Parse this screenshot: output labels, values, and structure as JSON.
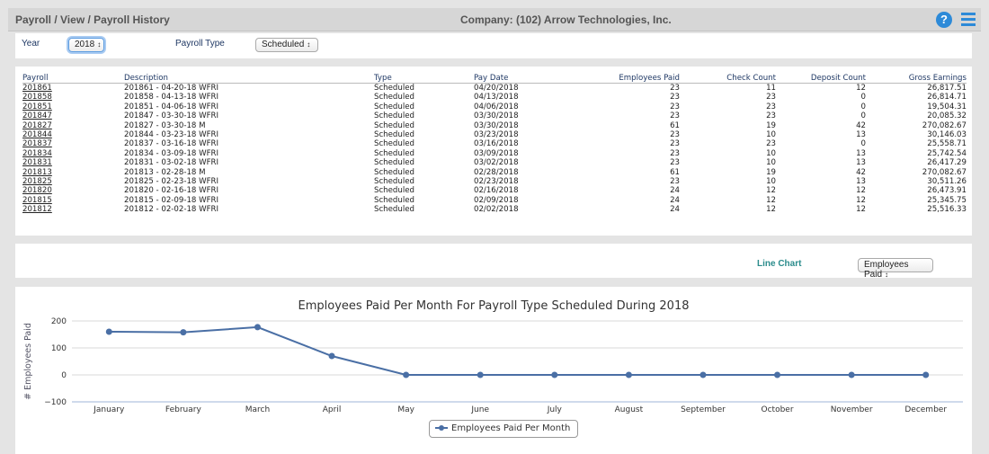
{
  "header": {
    "breadcrumb": "Payroll / View / Payroll History",
    "company": "Company: (102) Arrow Technologies, Inc.",
    "help_icon": "question-icon",
    "menu_icon": "list-menu-icon"
  },
  "filters": {
    "year_label": "Year",
    "year_value": "2018",
    "payroll_type_label": "Payroll Type",
    "payroll_type_value": "Scheduled"
  },
  "table": {
    "headers": [
      "Payroll",
      "Description",
      "Type",
      "Pay Date",
      "Employees Paid",
      "Check Count",
      "Deposit Count",
      "Gross Earnings"
    ],
    "rows": [
      [
        "201861",
        "201861 - 04-20-18 WFRI",
        "Scheduled",
        "04/20/2018",
        "23",
        "11",
        "12",
        "26,817.51"
      ],
      [
        "201858",
        "201858 - 04-13-18 WFRI",
        "Scheduled",
        "04/13/2018",
        "23",
        "23",
        "0",
        "26,814.71"
      ],
      [
        "201851",
        "201851 - 04-06-18 WFRI",
        "Scheduled",
        "04/06/2018",
        "23",
        "23",
        "0",
        "19,504.31"
      ],
      [
        "201847",
        "201847 - 03-30-18 WFRI",
        "Scheduled",
        "03/30/2018",
        "23",
        "23",
        "0",
        "20,085.32"
      ],
      [
        "201827",
        "201827 - 03-30-18 M",
        "Scheduled",
        "03/30/2018",
        "61",
        "19",
        "42",
        "270,082.67"
      ],
      [
        "201844",
        "201844 - 03-23-18 WFRI",
        "Scheduled",
        "03/23/2018",
        "23",
        "10",
        "13",
        "30,146.03"
      ],
      [
        "201837",
        "201837 - 03-16-18 WFRI",
        "Scheduled",
        "03/16/2018",
        "23",
        "23",
        "0",
        "25,558.71"
      ],
      [
        "201834",
        "201834 - 03-09-18 WFRI",
        "Scheduled",
        "03/09/2018",
        "23",
        "10",
        "13",
        "25,742.54"
      ],
      [
        "201831",
        "201831 - 03-02-18 WFRI",
        "Scheduled",
        "03/02/2018",
        "23",
        "10",
        "13",
        "26,417.29"
      ],
      [
        "201813",
        "201813 - 02-28-18 M",
        "Scheduled",
        "02/28/2018",
        "61",
        "19",
        "42",
        "270,082.67"
      ],
      [
        "201825",
        "201825 - 02-23-18 WFRI",
        "Scheduled",
        "02/23/2018",
        "23",
        "10",
        "13",
        "30,511.26"
      ],
      [
        "201820",
        "201820 - 02-16-18 WFRI",
        "Scheduled",
        "02/16/2018",
        "24",
        "12",
        "12",
        "26,473.91"
      ],
      [
        "201815",
        "201815 - 02-09-18 WFRI",
        "Scheduled",
        "02/09/2018",
        "24",
        "12",
        "12",
        "25,345.75"
      ],
      [
        "201812",
        "201812 - 02-02-18 WFRI",
        "Scheduled",
        "02/02/2018",
        "24",
        "12",
        "12",
        "25,516.33"
      ]
    ]
  },
  "chart_controls": {
    "label": "Line Chart",
    "metric_value": "Employees Paid"
  },
  "colors": {
    "accent": "#2d8ad8",
    "series": "#4a6fa5",
    "chart_label": "#2b8c8c"
  },
  "chart_data": {
    "type": "line",
    "title": "Employees Paid Per Month For Payroll Type Scheduled During 2018",
    "xlabel": "",
    "ylabel": "# Employees Paid",
    "categories": [
      "January",
      "February",
      "March",
      "April",
      "May",
      "June",
      "July",
      "August",
      "September",
      "October",
      "November",
      "December"
    ],
    "series": [
      {
        "name": "Employees Paid Per Month",
        "values": [
          160,
          158,
          177,
          70,
          0,
          0,
          0,
          0,
          0,
          0,
          0,
          0
        ]
      }
    ],
    "yticks": [
      "200",
      "100",
      "0",
      "−100"
    ],
    "ylim": [
      -100,
      200
    ],
    "grid": true,
    "legend_position": "bottom-center"
  }
}
